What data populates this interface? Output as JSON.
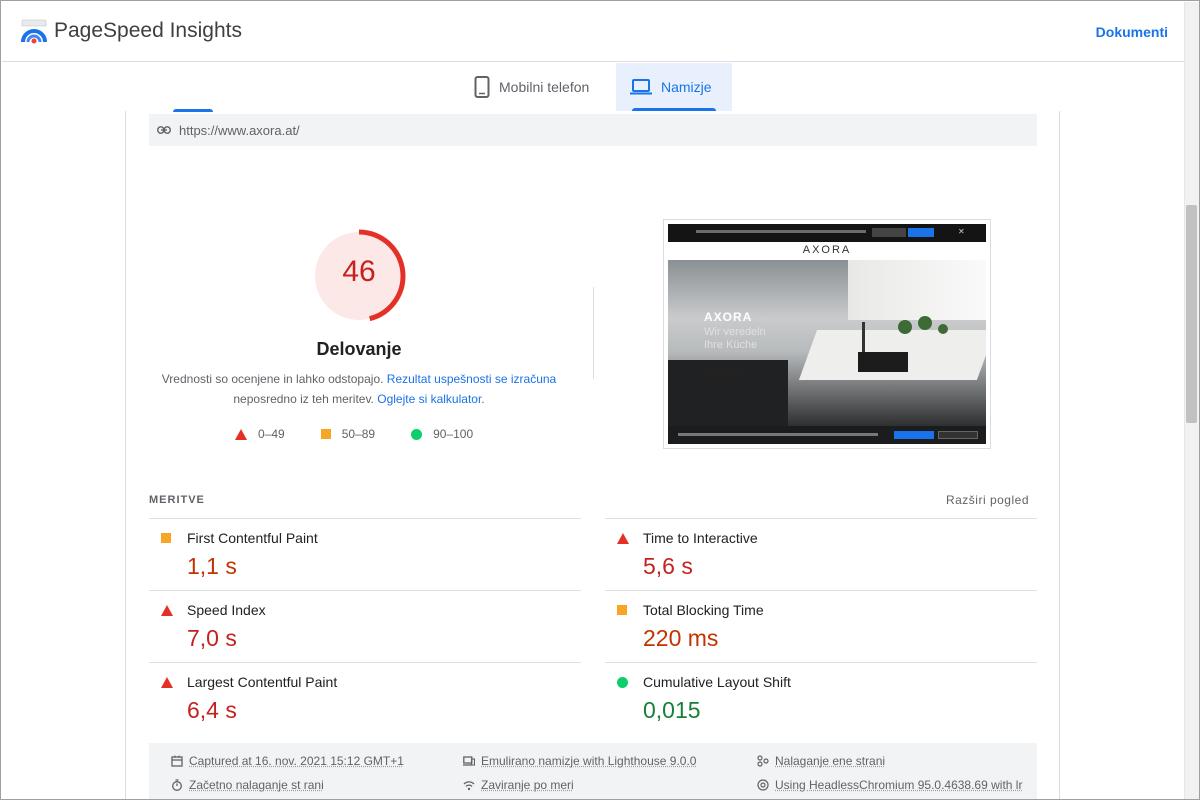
{
  "app": {
    "title": "PageSpeed Insights",
    "docs_label": "Dokumenti"
  },
  "tabs": [
    {
      "label": "Mobilni telefon",
      "icon": "smartphone-icon",
      "active": false
    },
    {
      "label": "Namizje",
      "icon": "laptop-icon",
      "active": true
    }
  ],
  "report": {
    "url": "https://www.axora.at/",
    "score": "46",
    "score_fraction": 0.46,
    "score_title": "Delovanje",
    "note_text_1": "Vrednosti so ocenjene in lahko odstopajo. ",
    "note_link_1": "Rezultat uspešnosti se izračuna",
    "note_text_2": "neposredno iz teh meritev. ",
    "note_link_2": "Oglejte si kalkulator.",
    "legend": [
      {
        "shape": "triangle",
        "color": "#e33127",
        "label": "0–49"
      },
      {
        "shape": "square",
        "color": "#f6a623",
        "label": "50–89"
      },
      {
        "shape": "circle",
        "color": "#0cce6b",
        "label": "90–100"
      }
    ],
    "screenshot": {
      "brand": "AXORA",
      "hero_title": "AXORA",
      "hero_subtitle": "Wir veredeln Ihre Küche"
    }
  },
  "metrics": {
    "label": "MERITVE",
    "expand_label": "Razširi pogled",
    "items": [
      {
        "name": "First Contentful Paint",
        "value": "1,1 s",
        "rating": "average"
      },
      {
        "name": "Time to Interactive",
        "value": "5,6 s",
        "rating": "fail"
      },
      {
        "name": "Speed Index",
        "value": "7,0 s",
        "rating": "fail"
      },
      {
        "name": "Total Blocking Time",
        "value": "220 ms",
        "rating": "average"
      },
      {
        "name": "Largest Contentful Paint",
        "value": "6,4 s",
        "rating": "fail"
      },
      {
        "name": "Cumulative Layout Shift",
        "value": "0,015",
        "rating": "pass"
      }
    ]
  },
  "runtime": {
    "items": [
      {
        "icon": "calendar-icon",
        "label": "Captured at 16. nov. 2021 15:12 GMT+1"
      },
      {
        "icon": "devices-icon",
        "label": "Emulirano namizje with Lighthouse 9.0.0"
      },
      {
        "icon": "page-load-icon",
        "label": "Nalaganje ene strani"
      },
      {
        "icon": "timer-icon",
        "label": "Začetno nalaganje st rani"
      },
      {
        "icon": "wifi-icon",
        "label": "Zaviranje po meri"
      },
      {
        "icon": "chromium-icon",
        "label": "Using HeadlessChromium 95.0.4638.69 with lr"
      }
    ]
  }
}
